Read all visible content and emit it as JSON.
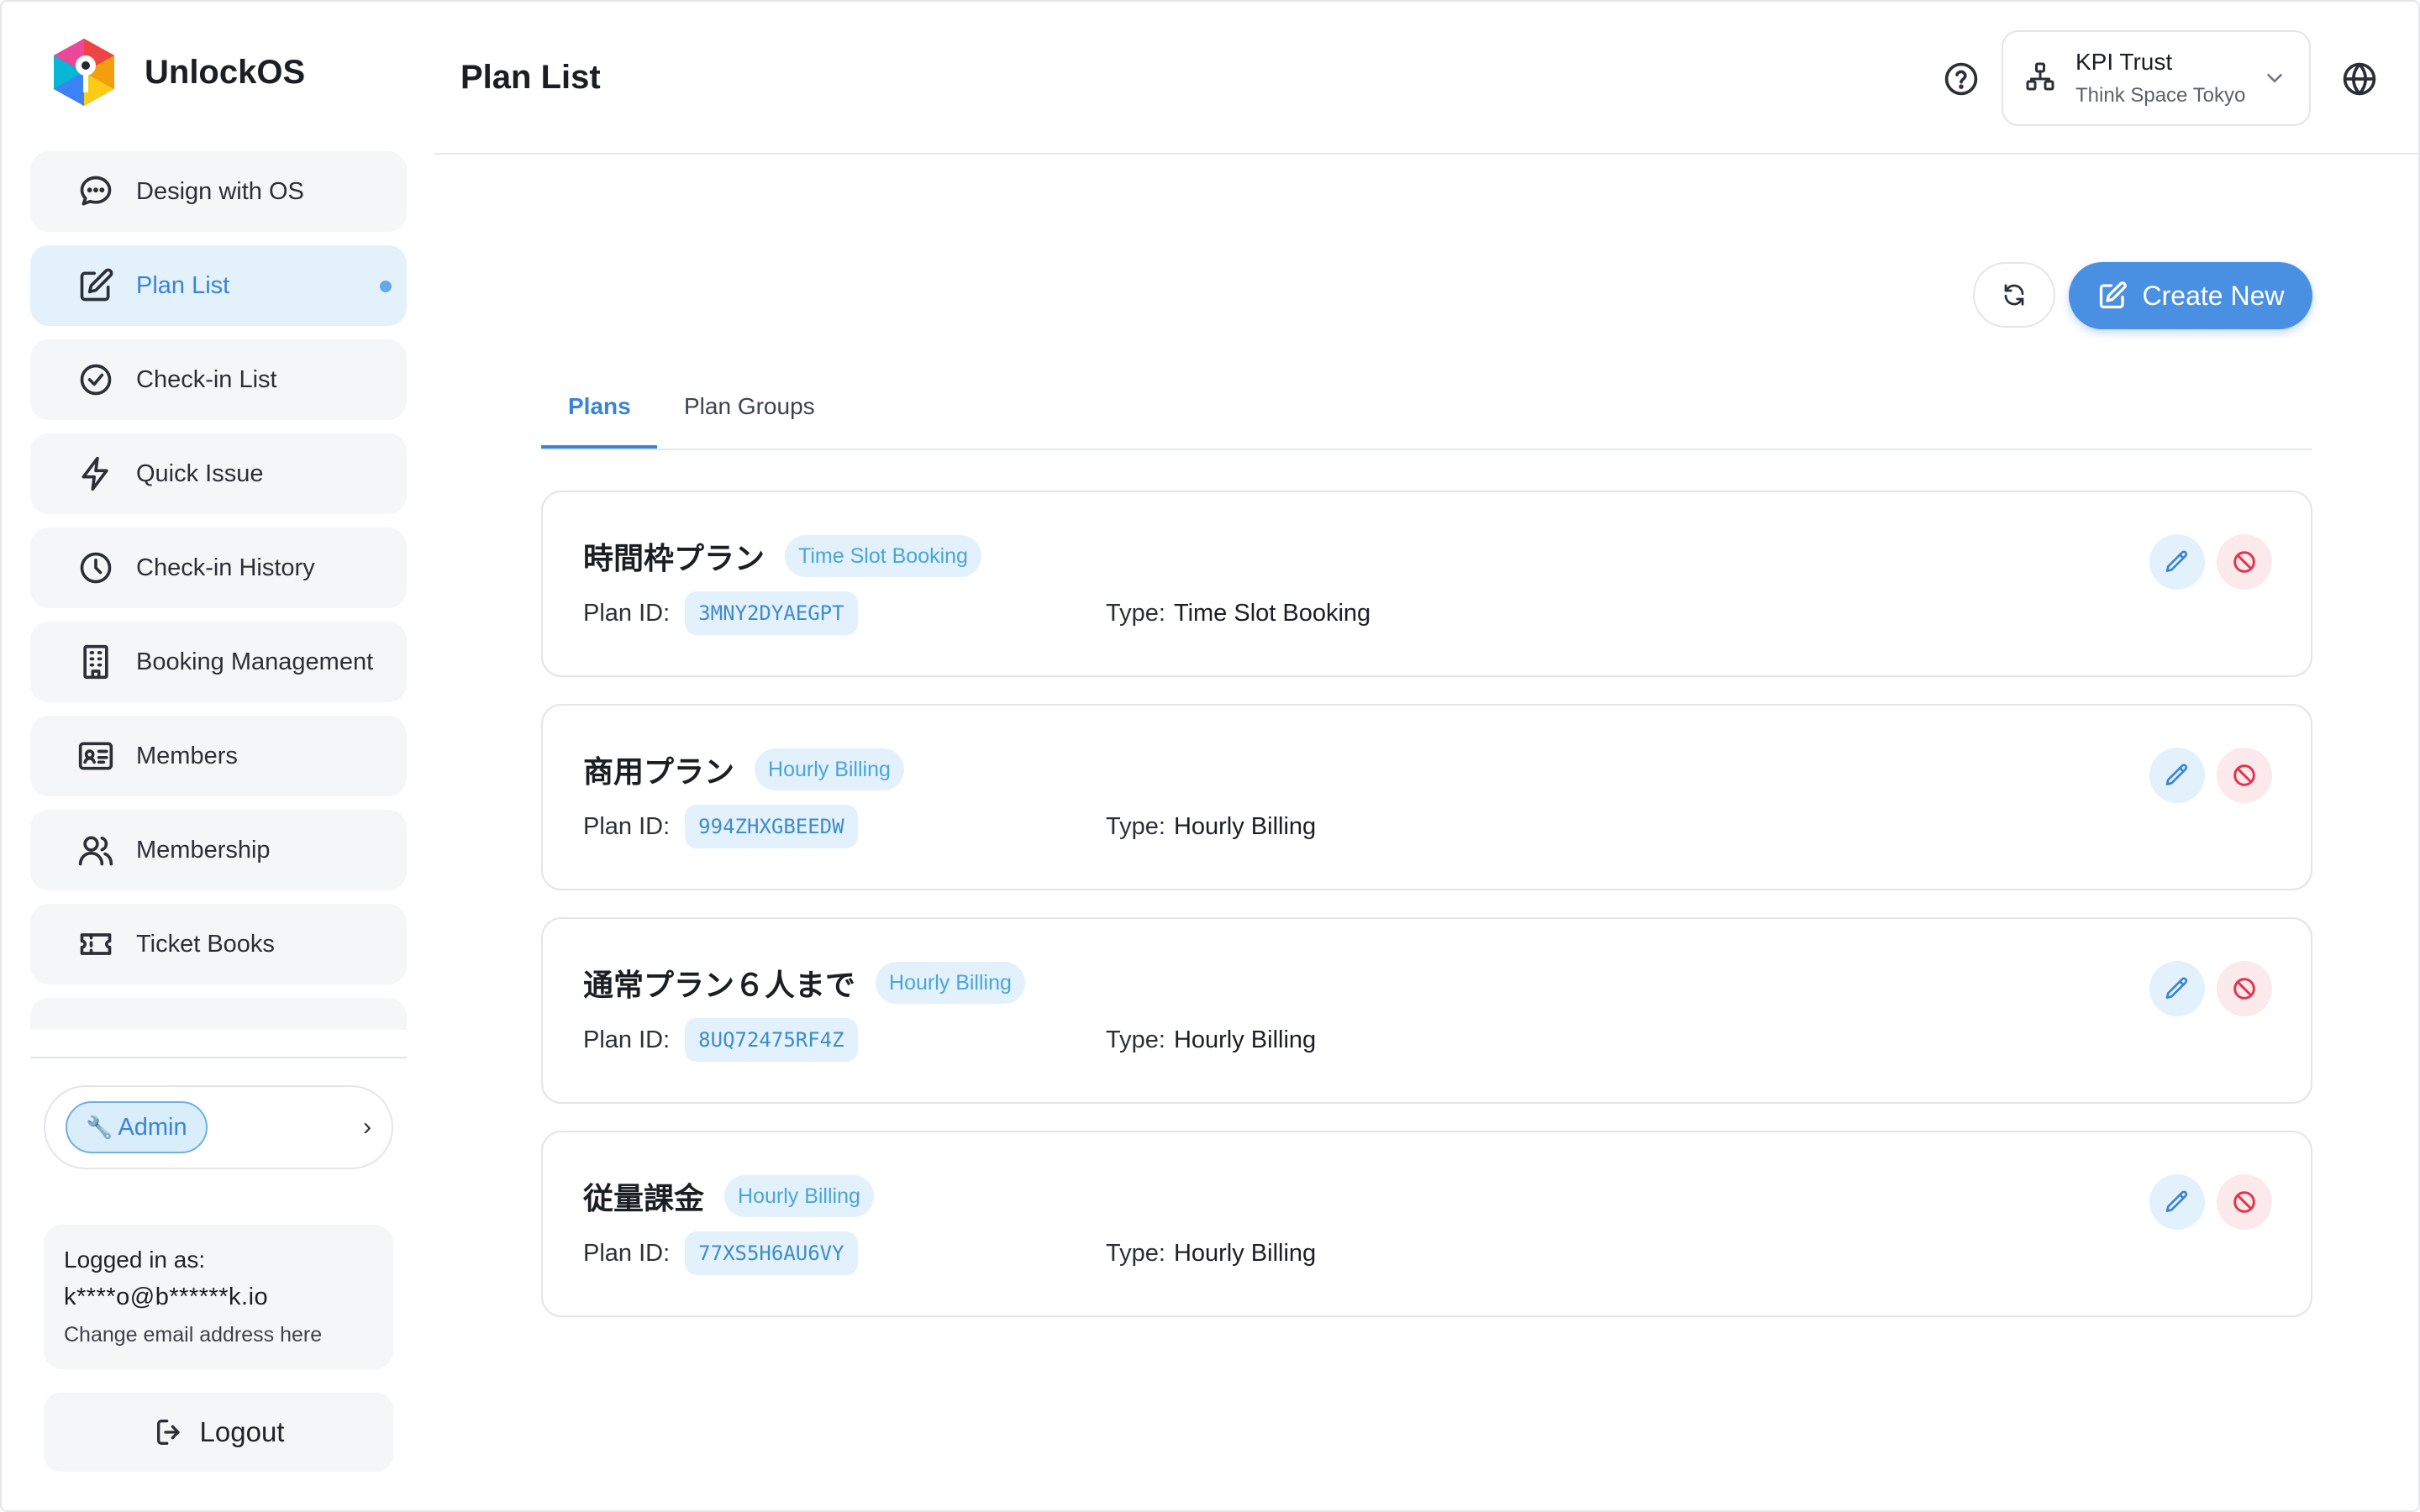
{
  "app": {
    "name": "UnlockOS",
    "accent": "#4a90e2"
  },
  "sidebar": {
    "items": [
      {
        "label": "Design with OS",
        "icon": "chat-bubble-icon",
        "active": false
      },
      {
        "label": "Plan List",
        "icon": "edit-square-icon",
        "active": true
      },
      {
        "label": "Check-in List",
        "icon": "check-circle-icon",
        "active": false
      },
      {
        "label": "Quick Issue",
        "icon": "lightning-icon",
        "active": false
      },
      {
        "label": "Check-in History",
        "icon": "clock-icon",
        "active": false
      },
      {
        "label": "Booking Management",
        "icon": "building-icon",
        "active": false
      },
      {
        "label": "Members",
        "icon": "id-card-icon",
        "active": false
      },
      {
        "label": "Membership",
        "icon": "users-icon",
        "active": false
      },
      {
        "label": "Ticket Books",
        "icon": "ticket-icon",
        "active": false
      },
      {
        "label": "",
        "icon": "partial-icon",
        "active": false
      }
    ],
    "admin": {
      "label": "Admin",
      "icon": "wrench-icon"
    },
    "login": {
      "label": "Logged in as:",
      "email": "k****o@b******k.io",
      "change_email": "Change email address here"
    },
    "logout_label": "Logout"
  },
  "header": {
    "title": "Plan List",
    "org": {
      "name": "KPI Trust",
      "location": "Think Space Tokyo"
    }
  },
  "toolbar": {
    "create_label": "Create New"
  },
  "tabs": [
    {
      "label": "Plans",
      "active": true
    },
    {
      "label": "Plan Groups",
      "active": false
    }
  ],
  "plans": [
    {
      "name": "時間枠プラン",
      "tag": "Time Slot Booking",
      "id_label": "Plan ID:",
      "id": "3MNY2DYAEGPT",
      "type_label": "Type:",
      "type": "Time Slot Booking"
    },
    {
      "name": "商用プラン",
      "tag": "Hourly Billing",
      "id_label": "Plan ID:",
      "id": "994ZHXGBEEDW",
      "type_label": "Type:",
      "type": "Hourly Billing"
    },
    {
      "name": "通常プラン６人まで",
      "tag": "Hourly Billing",
      "id_label": "Plan ID:",
      "id": "8UQ72475RF4Z",
      "type_label": "Type:",
      "type": "Hourly Billing"
    },
    {
      "name": "従量課金",
      "tag": "Hourly Billing",
      "id_label": "Plan ID:",
      "id": "77XS5H6AU6VY",
      "type_label": "Type:",
      "type": "Hourly Billing"
    }
  ]
}
